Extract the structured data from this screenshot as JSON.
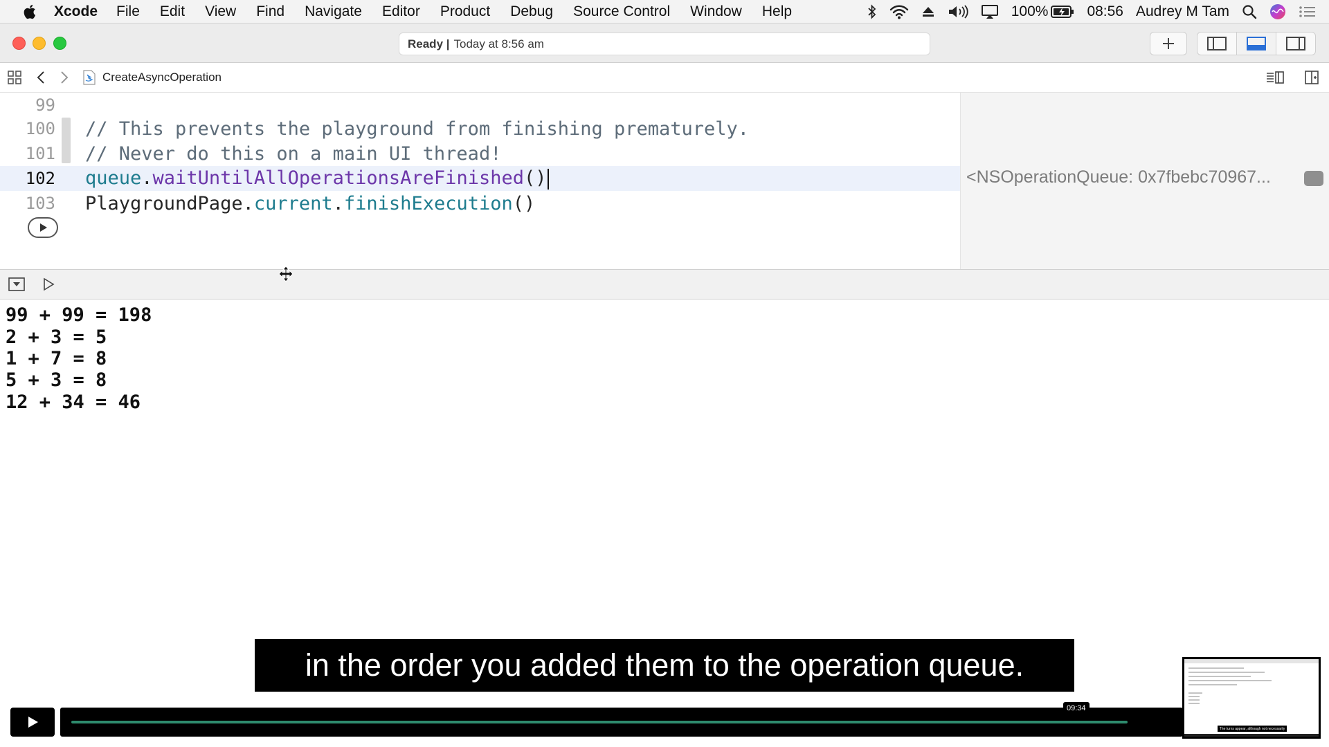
{
  "menubar": {
    "app_name": "Xcode",
    "menus": [
      "File",
      "Edit",
      "View",
      "Find",
      "Navigate",
      "Editor",
      "Product",
      "Debug",
      "Source Control",
      "Window",
      "Help"
    ],
    "battery": "100%",
    "clock": "08:56",
    "user": "Audrey M Tam"
  },
  "toolbar": {
    "activity_status": "Ready |",
    "activity_time": "Today at 8:56 am"
  },
  "jumpbar": {
    "file_name": "CreateAsyncOperation"
  },
  "editor": {
    "line_numbers": [
      "99",
      "100",
      "101",
      "102",
      "103"
    ],
    "current_line": "102",
    "line100": "// This prevents the playground from finishing prematurely.",
    "line101": "// Never do this on a main UI thread!",
    "line102": {
      "obj": "queue",
      "dot": ".",
      "method": "waitUntilAllOperationsAreFinished",
      "parens": "()"
    },
    "line103": {
      "obj": "PlaygroundPage",
      "dot1": ".",
      "prop": "current",
      "dot2": ".",
      "method": "finishExecution",
      "parens": "()"
    },
    "result_value": "<NSOperationQueue: 0x7fbebc70967..."
  },
  "console": {
    "lines": [
      "99 + 99 = 198",
      "2 + 3 = 5",
      "1 + 7 = 8",
      "5 + 3 = 8",
      "12 + 34 = 46"
    ]
  },
  "video": {
    "caption": "in the order you added them to the operation queue.",
    "timestamp": "09:34",
    "progress_fraction": 0.96,
    "thumbnail_caption": "The turns appear, although not necessarily"
  },
  "colors": {
    "comment": "#5d6c79",
    "property": "#1e7c8e",
    "function": "#6c36a9",
    "current_line_bg": "#ecf1fb",
    "progress": "#2e8b6d"
  },
  "icons": {
    "menubar_left": "apple-icon",
    "status": [
      "bluetooth-icon",
      "wifi-icon",
      "eject-icon",
      "volume-icon",
      "airplay-icon",
      "battery-icon",
      "search-icon",
      "siri-icon",
      "list-icon"
    ],
    "toolbar": [
      "add-icon",
      "navigator-toggle-icon",
      "debug-area-toggle-icon",
      "inspector-toggle-icon"
    ],
    "jumpbar": [
      "grid-icon",
      "back-icon",
      "forward-icon",
      "swift-file-icon",
      "editor-options-icon",
      "add-editor-icon"
    ]
  }
}
